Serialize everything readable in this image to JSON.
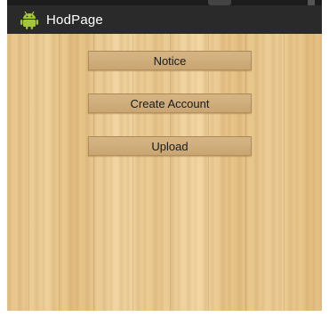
{
  "app": {
    "title": "HodPage",
    "icon": "android-icon",
    "accent_color": "#a4c639",
    "action_bar_color": "#2a2a2a"
  },
  "buttons": {
    "notice": "Notice",
    "create_account": "Create Account",
    "upload": "Upload"
  }
}
